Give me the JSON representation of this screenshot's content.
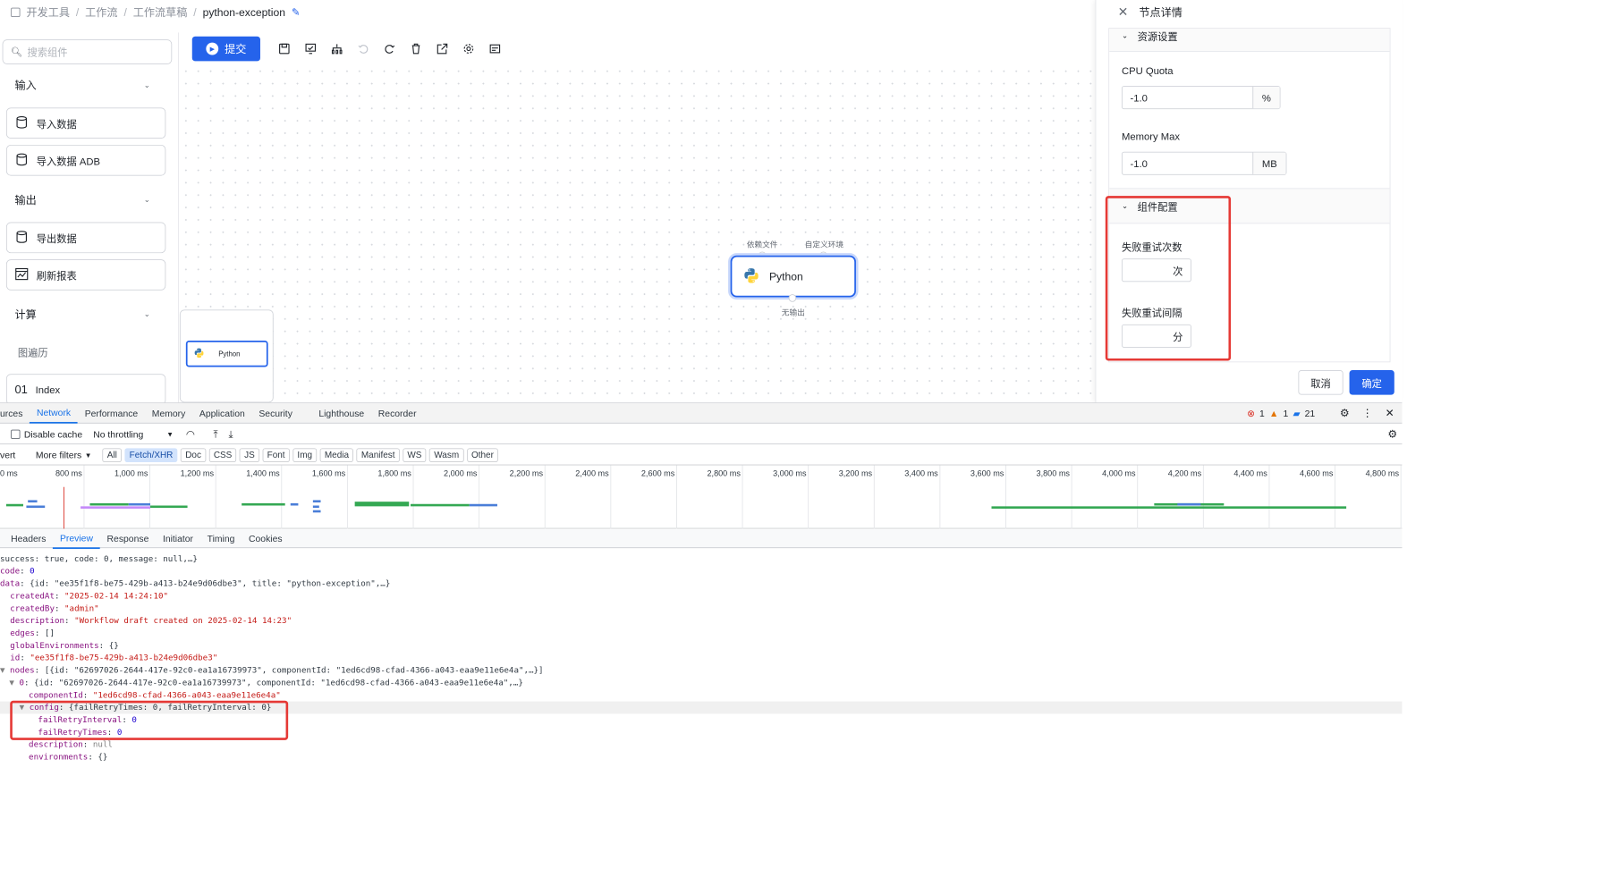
{
  "breadcrumb": {
    "items": [
      "开发工具",
      "工作流",
      "工作流草稿"
    ],
    "current": "python-exception"
  },
  "left_panel": {
    "search_placeholder": "搜索组件",
    "sections": [
      {
        "title": "输入",
        "items": [
          "导入数据",
          "导入数据 ADB"
        ]
      },
      {
        "title": "输出",
        "items": [
          "导出数据",
          "刷新报表"
        ]
      },
      {
        "title": "计算",
        "items": [
          "图遍历",
          "Index"
        ]
      }
    ],
    "index_prefix": "01"
  },
  "toolbar": {
    "submit_label": "提交"
  },
  "canvas": {
    "node_label": "Python",
    "port_top_left": "依赖文件",
    "port_top_right": "自定义环境",
    "port_bottom": "无输出",
    "minimap_node_label": "Python"
  },
  "node_detail": {
    "title": "节点详情",
    "collapsed_section": "资源设置",
    "cpu_label": "CPU Quota",
    "cpu_value": "-1.0",
    "cpu_unit": "%",
    "mem_label": "Memory Max",
    "mem_value": "-1.0",
    "mem_unit": "MB",
    "component_section": "组件配置",
    "retry_times_label": "失败重试次数",
    "retry_times_unit": "次",
    "retry_interval_label": "失败重试间隔",
    "retry_interval_unit": "分",
    "cancel_label": "取消",
    "ok_label": "确定"
  },
  "devtools": {
    "tabs": [
      "urces",
      "Network",
      "Performance",
      "Memory",
      "Application",
      "Security",
      "Lighthouse",
      "Recorder"
    ],
    "active_tab": "Network",
    "errors": "1",
    "warnings": "1",
    "messages": "21",
    "disable_cache": "Disable cache",
    "throttling": "No throttling",
    "invert": "vert",
    "more_filters": "More filters",
    "filters": [
      "All",
      "Fetch/XHR",
      "Doc",
      "CSS",
      "JS",
      "Font",
      "Img",
      "Media",
      "Manifest",
      "WS",
      "Wasm",
      "Other"
    ],
    "active_filter": "Fetch/XHR",
    "ticks": [
      "0 ms",
      "800 ms",
      "1,000 ms",
      "1,200 ms",
      "1,400 ms",
      "1,600 ms",
      "1,800 ms",
      "2,000 ms",
      "2,200 ms",
      "2,400 ms",
      "2,600 ms",
      "2,800 ms",
      "3,000 ms",
      "3,200 ms",
      "3,400 ms",
      "3,600 ms",
      "3,800 ms",
      "4,000 ms",
      "4,200 ms",
      "4,400 ms",
      "4,600 ms",
      "4,800 ms"
    ],
    "detail_tabs": [
      "Headers",
      "Preview",
      "Response",
      "Initiator",
      "Timing",
      "Cookies"
    ],
    "active_detail_tab": "Preview",
    "preview": {
      "l1": "success: true, code: 0, message: null,…}",
      "l2k": "code",
      "l2v": "0",
      "l3k": "data",
      "l3v": "{id: \"ee35f1f8-be75-429b-a413-b24e9d06dbe3\", title: \"python-exception\",…}",
      "l4k": "createdAt",
      "l4v": "\"2025-02-14 14:24:10\"",
      "l5k": "createdBy",
      "l5v": "\"admin\"",
      "l6k": "description",
      "l6v": "\"Workflow draft created on 2025-02-14 14:23\"",
      "l7k": "edges",
      "l7v": "[]",
      "l8k": "globalEnvironments",
      "l8v": "{}",
      "l9k": "id",
      "l9v": "\"ee35f1f8-be75-429b-a413-b24e9d06dbe3\"",
      "l10k": "nodes",
      "l10v": "[{id: \"62697026-2644-417e-92c0-ea1a16739973\", componentId: \"1ed6cd98-cfad-4366-a043-eaa9e11e6e4a\",…}]",
      "l11k": "0",
      "l11v": "{id: \"62697026-2644-417e-92c0-ea1a16739973\", componentId: \"1ed6cd98-cfad-4366-a043-eaa9e11e6e4a\",…}",
      "l12k": "componentId",
      "l12v": "\"1ed6cd98-cfad-4366-a043-eaa9e11e6e4a\"",
      "l13k": "config",
      "l13v": "{failRetryTimes: 0, failRetryInterval: 0}",
      "l14k": "failRetryInterval",
      "l14v": "0",
      "l15k": "failRetryTimes",
      "l15v": "0",
      "l16k": "description",
      "l16v": "null",
      "l17k": "environments",
      "l17v": "{}"
    }
  }
}
